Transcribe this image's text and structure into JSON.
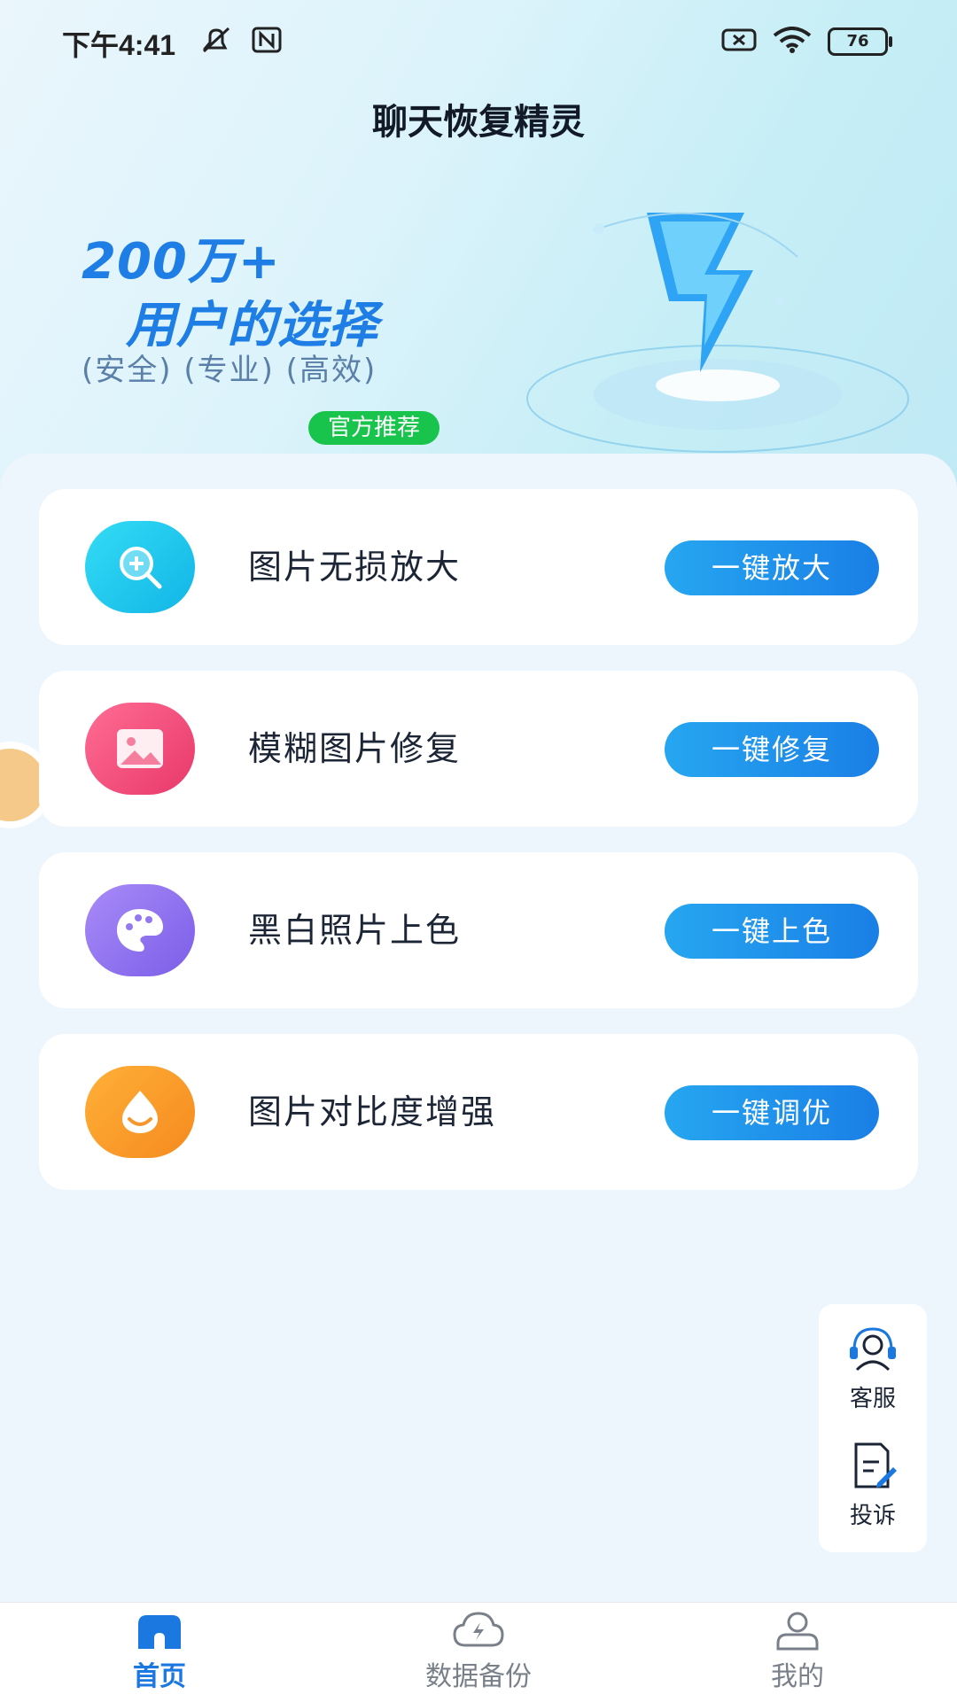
{
  "status_bar": {
    "time": "下午4:41",
    "battery": "76"
  },
  "header": {
    "title": "聊天恢复精灵"
  },
  "banner": {
    "headline_1": "200万+",
    "badge": "官方推荐",
    "headline_2": "用户的选择",
    "tags": "(安全) (专业) (高效)"
  },
  "features": [
    {
      "label": "图片无损放大",
      "button": "一键放大",
      "icon": "zoom-in-icon",
      "color": "#1fc6ec"
    },
    {
      "label": "模糊图片修复",
      "button": "一键修复",
      "icon": "image-icon",
      "color": "#ef4d7a"
    },
    {
      "label": "黑白照片上色",
      "button": "一键上色",
      "icon": "palette-icon",
      "color": "#8f75f0"
    },
    {
      "label": "图片对比度增强",
      "button": "一键调优",
      "icon": "contrast-icon",
      "color": "#f7962b"
    }
  ],
  "float_panel": {
    "service": "客服",
    "complaint": "投诉"
  },
  "bottom_nav": [
    {
      "label": "首页",
      "icon": "home-icon",
      "active": true
    },
    {
      "label": "数据备份",
      "icon": "cloud-backup-icon",
      "active": false
    },
    {
      "label": "我的",
      "icon": "profile-icon",
      "active": false
    }
  ],
  "colors": {
    "accent": "#1a7fe6",
    "badge_green": "#19c44c",
    "background": "#edf5fd"
  }
}
